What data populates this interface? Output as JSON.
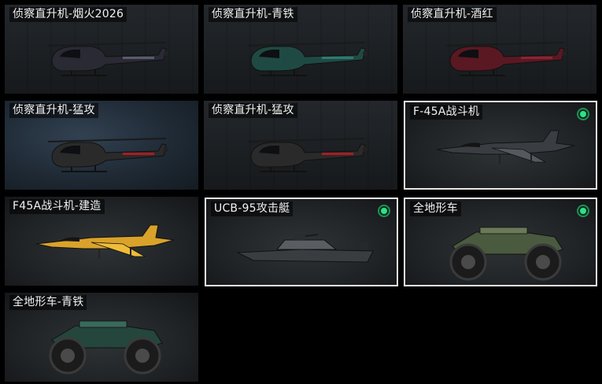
{
  "vehicles": [
    {
      "label": "侦察直升机-烟火2026",
      "kind": "heli",
      "color": "#2a2a35",
      "accent": "#5a5a70",
      "selected": false,
      "owned": false
    },
    {
      "label": "侦察直升机-青铁",
      "kind": "heli",
      "color": "#1f4a44",
      "accent": "#2f7a6e",
      "selected": false,
      "owned": false
    },
    {
      "label": "侦察直升机-酒红",
      "kind": "heli",
      "color": "#5a1822",
      "accent": "#8a2433",
      "selected": false,
      "owned": false
    },
    {
      "label": "侦察直升机-猛攻",
      "kind": "heli",
      "color": "#2a2a2a",
      "accent": "#a81d23",
      "selected": false,
      "owned": false
    },
    {
      "label": "侦察直升机-猛攻",
      "kind": "heli",
      "color": "#2a2a2a",
      "accent": "#a81d23",
      "selected": false,
      "owned": false
    },
    {
      "label": "F-45A战斗机",
      "kind": "jet",
      "color": "#3a3d42",
      "accent": "#55595f",
      "selected": true,
      "owned": true
    },
    {
      "label": "F45A战斗机-建造",
      "kind": "jet",
      "color": "#d9a22a",
      "accent": "#f0bd3a",
      "selected": false,
      "owned": false
    },
    {
      "label": "UCB-95攻击艇",
      "kind": "boat",
      "color": "#3a3d40",
      "accent": "#5a5e62",
      "selected": true,
      "owned": true
    },
    {
      "label": "全地形车",
      "kind": "atv",
      "color": "#4a5a3e",
      "accent": "#6a7a58",
      "selected": true,
      "owned": true
    },
    {
      "label": "全地形车-青铁",
      "kind": "atv",
      "color": "#24463c",
      "accent": "#3a6a5a",
      "selected": false,
      "owned": false
    }
  ],
  "status": {
    "owned_color": "#2fe08a",
    "selected_border": "#e6e6e6"
  }
}
